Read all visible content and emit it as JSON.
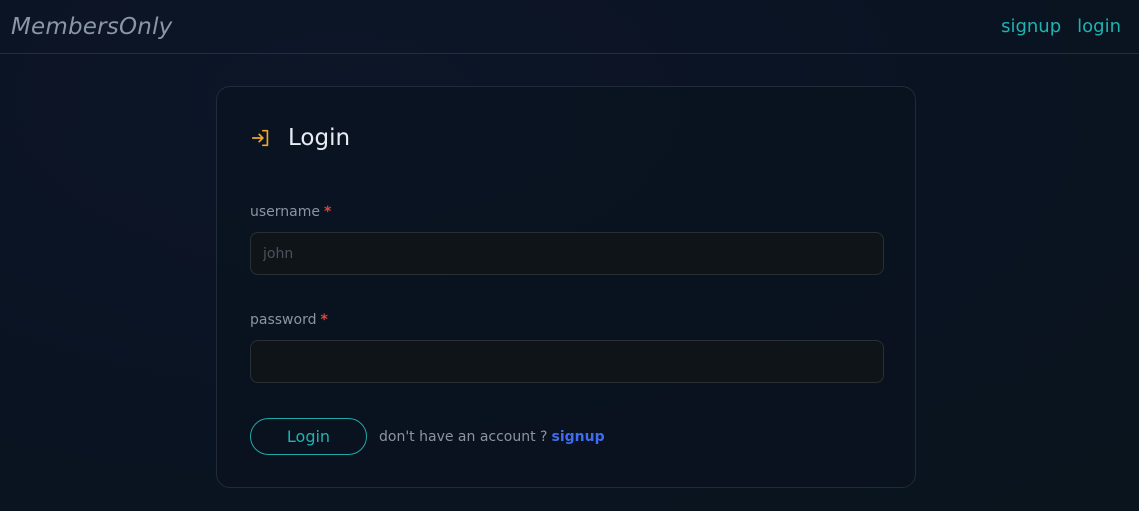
{
  "navbar": {
    "brand": "MembersOnly",
    "links": [
      {
        "label": "signup"
      },
      {
        "label": "login"
      }
    ]
  },
  "form": {
    "title": "Login",
    "icon": "login-arrow-icon",
    "username": {
      "label": "username",
      "required_mark": "*",
      "placeholder": "john",
      "value": ""
    },
    "password": {
      "label": "password",
      "required_mark": "*",
      "placeholder": "",
      "value": ""
    },
    "submit_label": "Login",
    "hint_text": "don't have an account ?",
    "hint_link": "signup"
  },
  "colors": {
    "accent": "#1eb3b0",
    "icon": "#f0a72a",
    "required": "#e0453a",
    "link": "#3d6cf0"
  }
}
